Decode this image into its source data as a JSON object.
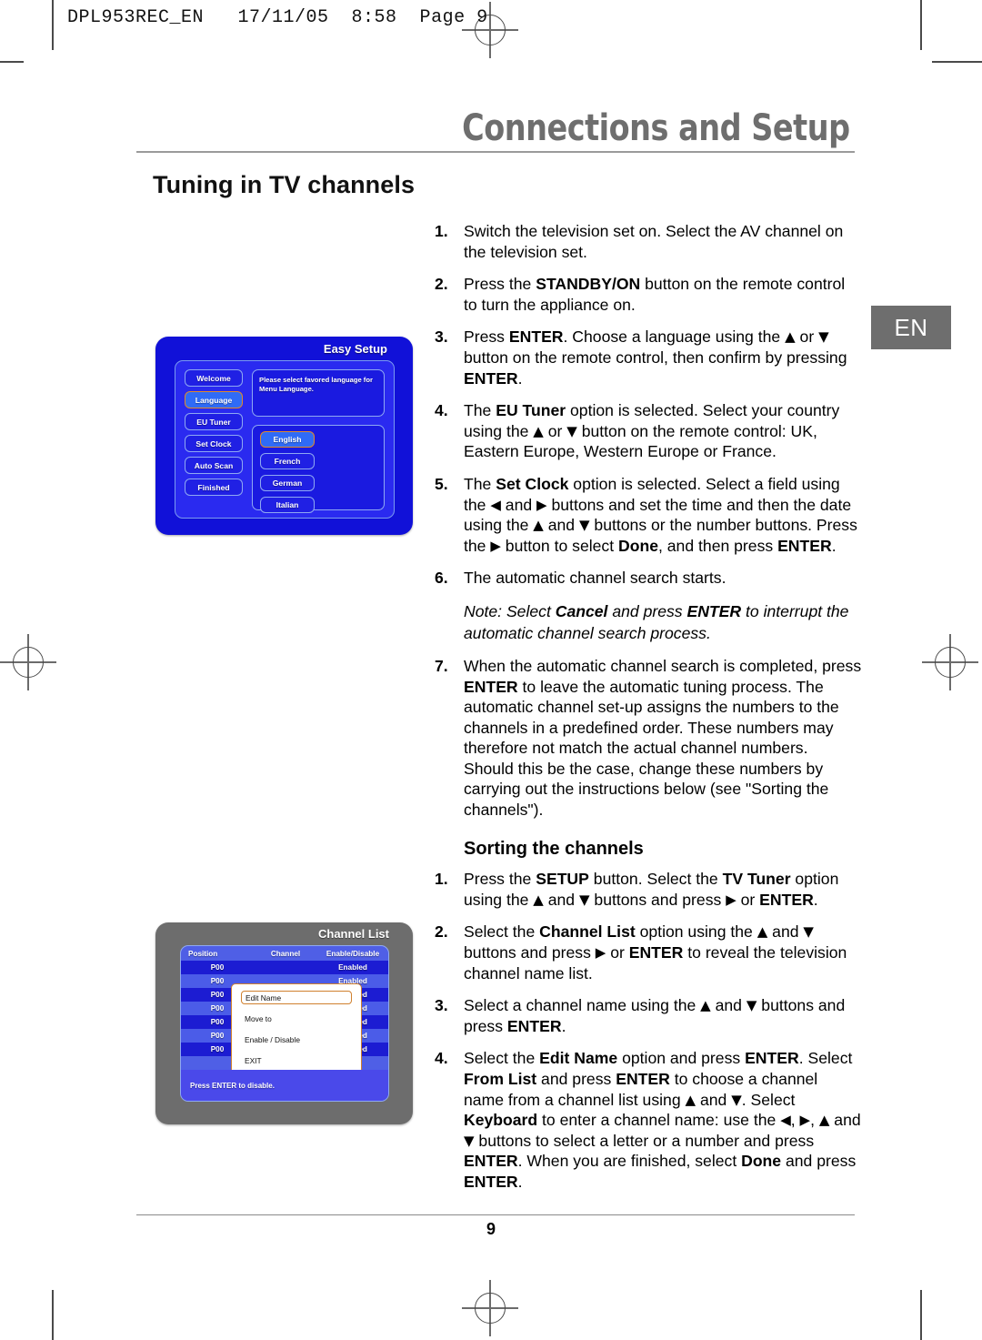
{
  "print_header": "DPL953REC_EN   17/11/05  8:58  Page 9",
  "chapter_title": "Connections and Setup",
  "section_title": "Tuning in TV channels",
  "language_tab": "EN",
  "page_number": "9",
  "colors": {
    "chapter_gray": "#6e6e6e",
    "osd_blue": "#1111d8",
    "osd_gray": "#6d6d6d",
    "highlight_orange": "#d0802e",
    "selected_blue": "#2f6bf7"
  },
  "steps_main": [
    {
      "num": "1.",
      "html": "Switch the television set on. Select the AV channel on the television set."
    },
    {
      "num": "2.",
      "html": "Press the <b>STANDBY/ON</b> button on the remote control to turn the appliance on."
    },
    {
      "num": "3.",
      "html": "Press <b>ENTER</b>. Choose a language using the <span class=\"ar\">&#9650;</span> or <span class=\"ar\">&#9660;</span> button on the remote control, then confirm by pressing <b>ENTER</b>."
    },
    {
      "num": "4.",
      "html": "The <b>EU Tuner</b> option is selected. Select your country using the <span class=\"ar\">&#9650;</span> or <span class=\"ar\">&#9660;</span> button on the remote control: UK, Eastern Europe, Western Europe or France."
    },
    {
      "num": "5.",
      "html": "The <b>Set Clock</b> option is selected. Select a field using the <span class=\"ar\">&#9664;</span> and <span class=\"ar\">&#9654;</span> buttons and set the time and then the date using the <span class=\"ar\">&#9650;</span> and <span class=\"ar\">&#9660;</span> buttons or the number buttons. Press the <span class=\"ar\">&#9654;</span> button to select <b>Done</b>, and then press <b>ENTER</b>."
    },
    {
      "num": "6.",
      "html": "The automatic channel search starts."
    }
  ],
  "note": "Note: Select <b>Cancel</b> and press <b>ENTER</b> to interrupt the automatic channel search process.",
  "step7": {
    "num": "7.",
    "html": "When the automatic channel search is completed, press <b>ENTER</b> to leave the automatic tuning process. The automatic channel set-up assigns the numbers to the channels in a predefined order. These numbers may therefore not match the actual channel numbers. Should this be the case, change these numbers by carrying out the instructions below (see \"Sorting the channels\")."
  },
  "sub_heading": "Sorting the channels",
  "steps_sorting": [
    {
      "num": "1.",
      "html": "Press the <b>SETUP</b> button. Select the <b>TV Tuner</b> option using the <span class=\"ar\">&#9650;</span> and <span class=\"ar\">&#9660;</span> buttons and press <span class=\"ar\">&#9654;</span> or <b>ENTER</b>."
    },
    {
      "num": "2.",
      "html": "Select the <b>Channel List</b> option using the <span class=\"ar\">&#9650;</span> and <span class=\"ar\">&#9660;</span> buttons and press <span class=\"ar\">&#9654;</span> or <b>ENTER</b> to reveal the television channel name list."
    },
    {
      "num": "3.",
      "html": "Select a channel name using the <span class=\"ar\">&#9650;</span> and <span class=\"ar\">&#9660;</span> buttons and press <b>ENTER</b>."
    },
    {
      "num": "4.",
      "html": "Select the <b>Edit Name</b> option and press <b>ENTER</b>. Select <b>From List</b> and press <b>ENTER</b> to choose a channel name from a channel list using <span class=\"ar\">&#9650;</span> and <span class=\"ar\">&#9660;</span>. Select <b>Keyboard</b> to enter a channel name: use the <span class=\"ar\">&#9664;</span>, <span class=\"ar\">&#9654;</span>, <span class=\"ar\">&#9650;</span> and <span class=\"ar\">&#9660;</span> buttons to select a letter or a number and press <b>ENTER</b>. When you are finished, select <b>Done</b> and press <b>ENTER</b>."
    }
  ],
  "easy_setup": {
    "title": "Easy Setup",
    "menu_items": [
      {
        "label": "Welcome",
        "selected": false
      },
      {
        "label": "Language",
        "selected": true
      },
      {
        "label": "EU Tuner",
        "selected": false
      },
      {
        "label": "Set Clock",
        "selected": false
      },
      {
        "label": "Auto Scan",
        "selected": false
      },
      {
        "label": "Finished",
        "selected": false
      }
    ],
    "description": "Please select favored language for Menu Language.",
    "languages": [
      {
        "label": "English",
        "selected": true
      },
      {
        "label": "French",
        "selected": false
      },
      {
        "label": "German",
        "selected": false
      },
      {
        "label": "Italian",
        "selected": false
      }
    ]
  },
  "channel_list": {
    "title": "Channel List",
    "columns": [
      "Position",
      "Channel",
      "Enable/Disable"
    ],
    "rows": [
      {
        "position": "P00",
        "channel": "",
        "state": "Enabled"
      },
      {
        "position": "P00",
        "channel": "",
        "state": "Enabled"
      },
      {
        "position": "P00",
        "channel": "",
        "state": "Enabled"
      },
      {
        "position": "P00",
        "channel": "",
        "state": "Enabled"
      },
      {
        "position": "P00",
        "channel": "",
        "state": "Enabled"
      },
      {
        "position": "P00",
        "channel": "",
        "state": "Enabled"
      },
      {
        "position": "P00",
        "channel": "",
        "state": "Enabled"
      }
    ],
    "popup_items": [
      {
        "label": "Edit Name",
        "selected": true
      },
      {
        "label": "Move to",
        "selected": false
      },
      {
        "label": "Enable / Disable",
        "selected": false
      },
      {
        "label": "EXIT",
        "selected": false
      }
    ],
    "footer": "Press ENTER to disable."
  }
}
